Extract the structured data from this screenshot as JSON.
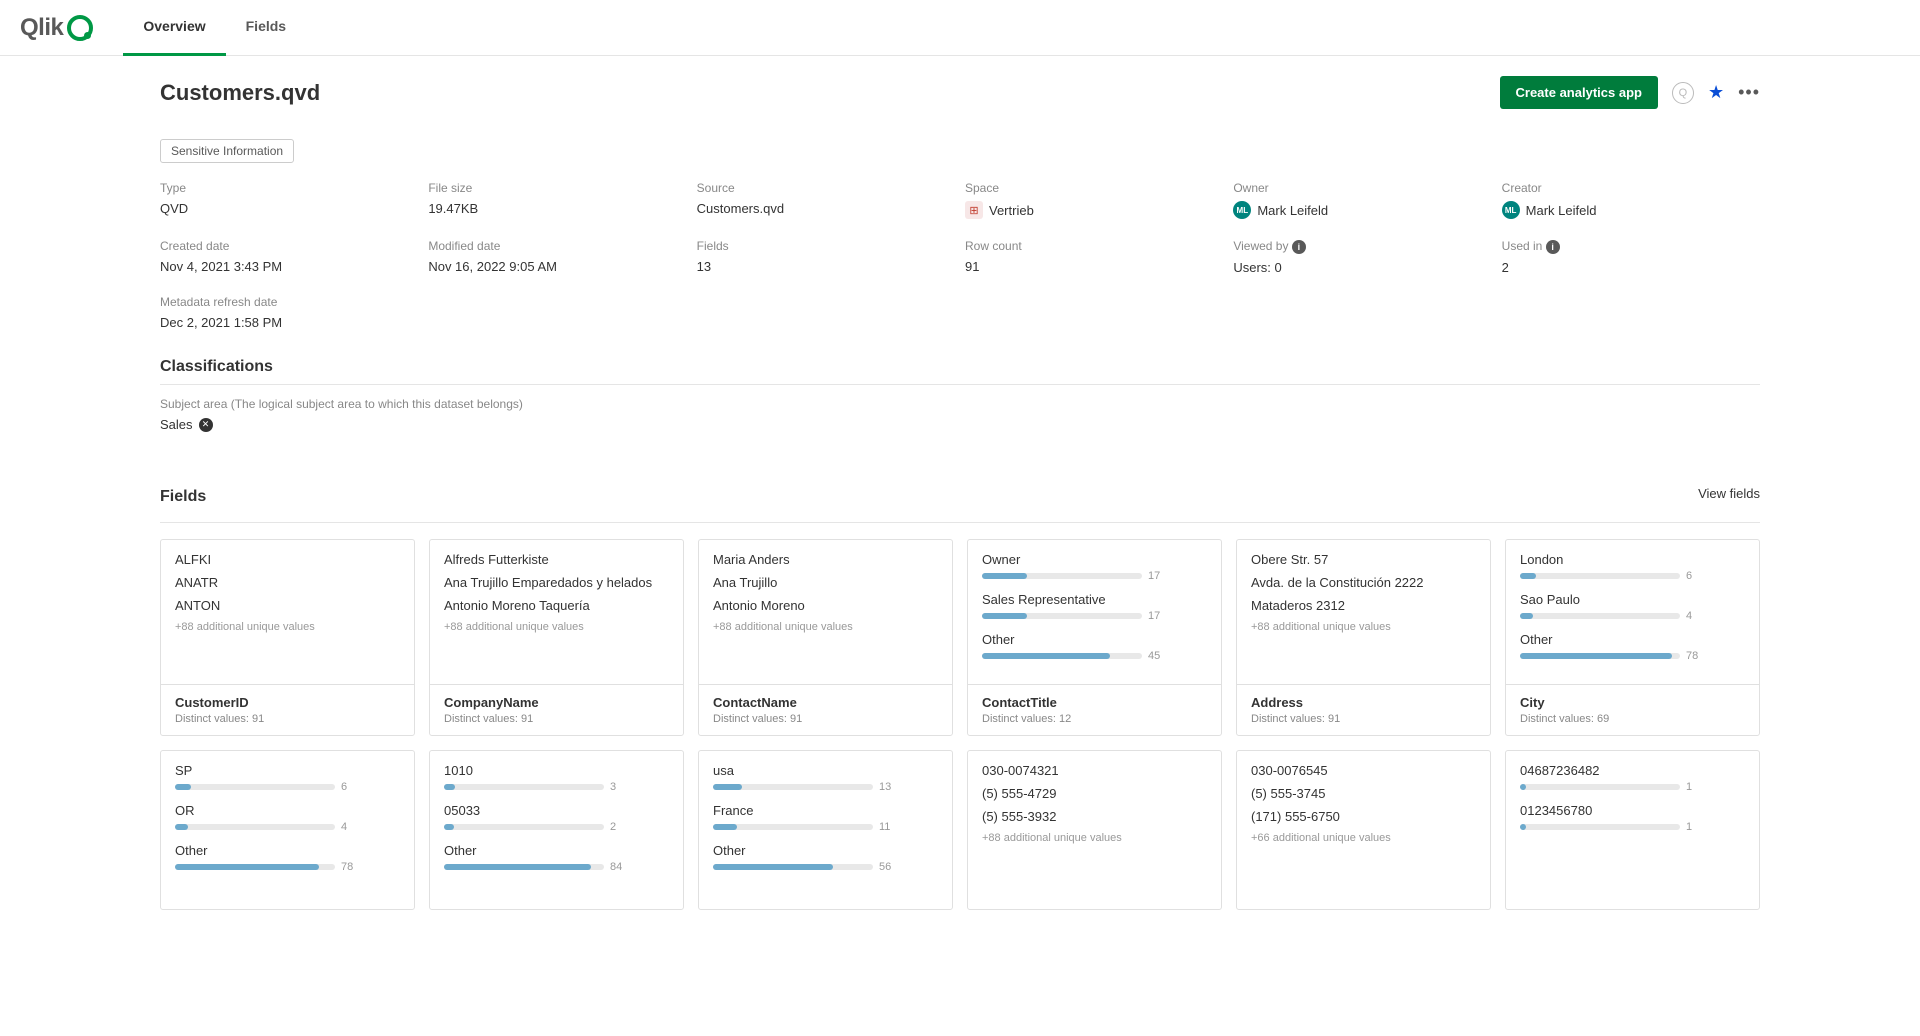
{
  "tabs": {
    "overview": "Overview",
    "fields": "Fields"
  },
  "page_title": "Customers.qvd",
  "actions": {
    "create_app": "Create analytics app"
  },
  "tag": "Sensitive Information",
  "meta": {
    "type_label": "Type",
    "type_value": "QVD",
    "filesize_label": "File size",
    "filesize_value": "19.47KB",
    "source_label": "Source",
    "source_value": "Customers.qvd",
    "space_label": "Space",
    "space_value": "Vertrieb",
    "owner_label": "Owner",
    "owner_value": "Mark Leifeld",
    "creator_label": "Creator",
    "creator_value": "Mark Leifeld",
    "created_label": "Created date",
    "created_value": "Nov 4, 2021 3:43 PM",
    "modified_label": "Modified date",
    "modified_value": "Nov 16, 2022 9:05 AM",
    "fields_label": "Fields",
    "fields_value": "13",
    "rows_label": "Row count",
    "rows_value": "91",
    "viewed_label": "Viewed by",
    "viewed_value": "Users: 0",
    "usedin_label": "Used in",
    "usedin_value": "2",
    "refresh_label": "Metadata refresh date",
    "refresh_value": "Dec 2, 2021 1:58 PM"
  },
  "classifications": {
    "title": "Classifications",
    "subject_label": "Subject area (The logical subject area to which this dataset belongs)",
    "subject_value": "Sales"
  },
  "fields_section": {
    "title": "Fields",
    "view_link": "View fields"
  },
  "field_cards": [
    {
      "type": "list",
      "values": [
        "ALFKI",
        "ANATR",
        "ANTON"
      ],
      "more": "+88 additional unique values",
      "name": "CustomerID",
      "distinct": "Distinct values: 91"
    },
    {
      "type": "list",
      "values": [
        "Alfreds Futterkiste",
        "Ana Trujillo Emparedados y helados",
        "Antonio Moreno Taquería"
      ],
      "more": "+88 additional unique values",
      "name": "CompanyName",
      "distinct": "Distinct values: 91"
    },
    {
      "type": "list",
      "values": [
        "Maria Anders",
        "Ana Trujillo",
        "Antonio Moreno"
      ],
      "more": "+88 additional unique values",
      "name": "ContactName",
      "distinct": "Distinct values: 91"
    },
    {
      "type": "bars",
      "bars": [
        {
          "label": "Owner",
          "count": 17,
          "pct": 28
        },
        {
          "label": "Sales Representative",
          "count": 17,
          "pct": 28
        },
        {
          "label": "Other",
          "count": 45,
          "pct": 80
        }
      ],
      "name": "ContactTitle",
      "distinct": "Distinct values: 12"
    },
    {
      "type": "list",
      "values": [
        "Obere Str. 57",
        "Avda. de la Constitución 2222",
        "Mataderos 2312"
      ],
      "more": "+88 additional unique values",
      "name": "Address",
      "distinct": "Distinct values: 91"
    },
    {
      "type": "bars",
      "bars": [
        {
          "label": "London",
          "count": 6,
          "pct": 10
        },
        {
          "label": "Sao Paulo",
          "count": 4,
          "pct": 8
        },
        {
          "label": "Other",
          "count": 78,
          "pct": 95
        }
      ],
      "name": "City",
      "distinct": "Distinct values: 69"
    }
  ],
  "field_cards_row2": [
    {
      "type": "bars",
      "bars": [
        {
          "label": "SP",
          "count": 6,
          "pct": 10
        },
        {
          "label": "OR",
          "count": 4,
          "pct": 8
        },
        {
          "label": "Other",
          "count": 78,
          "pct": 90
        }
      ],
      "bottom_count": "78"
    },
    {
      "type": "bars",
      "bars": [
        {
          "label": "1010",
          "count": 3,
          "pct": 7
        },
        {
          "label": "05033",
          "count": 2,
          "pct": 6
        },
        {
          "label": "Other",
          "count": 84,
          "pct": 92
        }
      ],
      "bottom_count": "84"
    },
    {
      "type": "bars",
      "bars": [
        {
          "label": "usa",
          "count": 13,
          "pct": 18
        },
        {
          "label": "France",
          "count": 11,
          "pct": 15
        },
        {
          "label": "Other",
          "count": 56,
          "pct": 75
        }
      ],
      "bottom_count": "56"
    },
    {
      "type": "list",
      "values": [
        "030-0074321",
        "(5) 555-4729",
        "(5) 555-3932"
      ],
      "more": "+88 additional unique values"
    },
    {
      "type": "list",
      "values": [
        "030-0076545",
        "(5) 555-3745",
        "(171) 555-6750"
      ],
      "more": "+66 additional unique values"
    },
    {
      "type": "bars",
      "bars": [
        {
          "label": "04687236482",
          "count": 1,
          "pct": 4
        },
        {
          "label": "0123456780",
          "count": 1,
          "pct": 4
        }
      ]
    }
  ]
}
